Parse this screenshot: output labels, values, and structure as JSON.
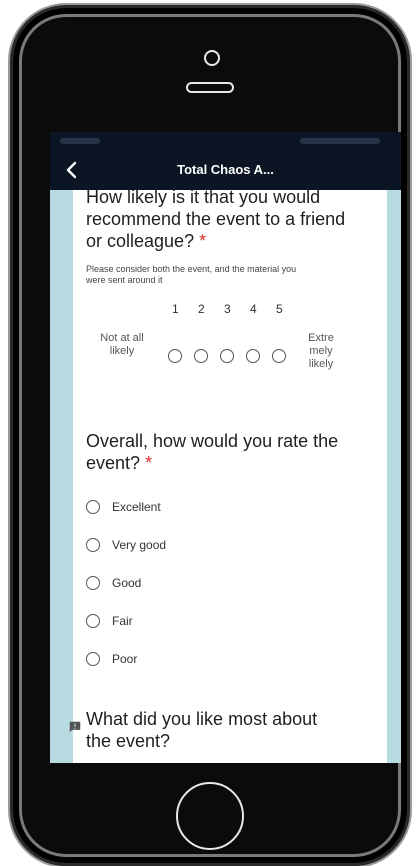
{
  "app": {
    "title": "Total Chaos A..."
  },
  "question_recommend": {
    "text": "How likely is it that you would recommend the event to a friend or colleague?",
    "required_mark": "*",
    "helper": "Please consider both the event, and the material you were sent around it",
    "scale": {
      "numbers": [
        "1",
        "2",
        "3",
        "4",
        "5"
      ],
      "low_label": "Not at all likely",
      "high_label": "Extre mely likely"
    }
  },
  "question_overall": {
    "text": "Overall, how would you rate the event?",
    "required_mark": "*",
    "options": [
      "Excellent",
      "Very good",
      "Good",
      "Fair",
      "Poor"
    ]
  },
  "question_like": {
    "text": "What did you like most about the event?"
  },
  "colors": {
    "appbar": "#0b1524",
    "background": "#b8dbe2",
    "required": "#d93025"
  },
  "icons": [
    "back-arrow-icon",
    "feedback-icon",
    "camera-icon",
    "speaker-icon",
    "home-button-icon"
  ]
}
